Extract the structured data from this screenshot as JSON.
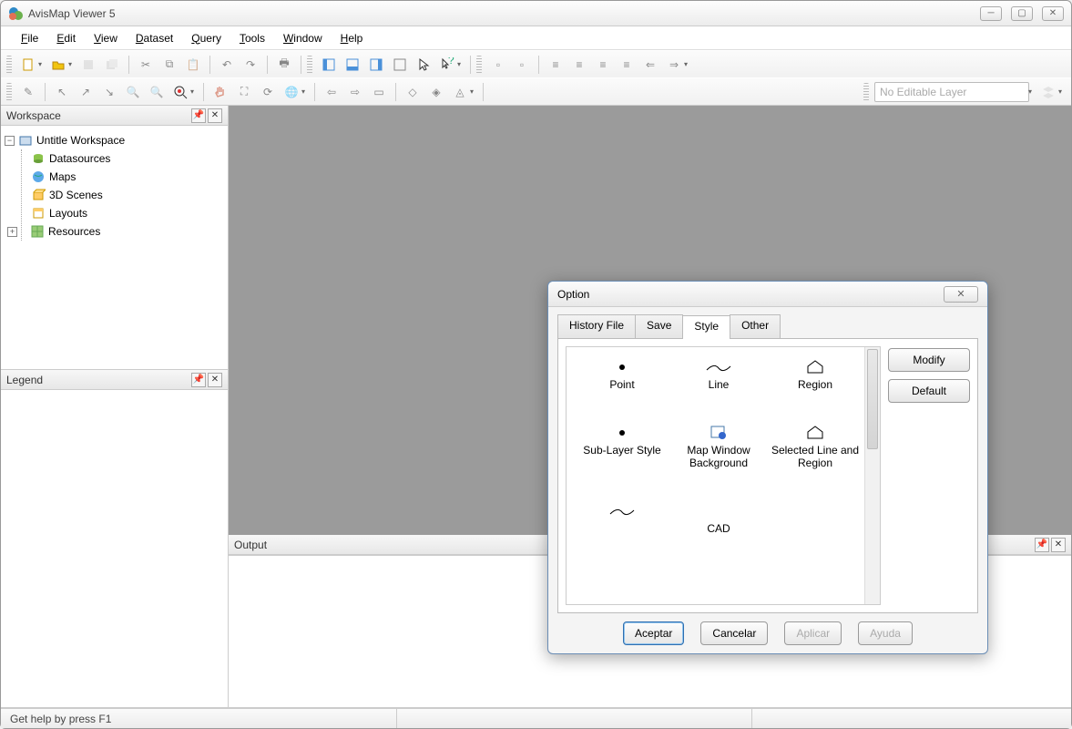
{
  "window": {
    "title": "AvisMap Viewer 5"
  },
  "menu": {
    "items": [
      "File",
      "Edit",
      "View",
      "Dataset",
      "Query",
      "Tools",
      "Window",
      "Help"
    ]
  },
  "layerCombo": {
    "placeholder": "No Editable Layer"
  },
  "panels": {
    "workspace": {
      "title": "Workspace",
      "root": "Untitle Workspace",
      "children": [
        "Datasources",
        "Maps",
        "3D Scenes",
        "Layouts",
        "Resources"
      ]
    },
    "legend": {
      "title": "Legend"
    },
    "output": {
      "title": "Output"
    }
  },
  "dialog": {
    "title": "Option",
    "tabs": [
      "History File",
      "Save",
      "Style",
      "Other"
    ],
    "activeTab": "Style",
    "styleItems": [
      "Point",
      "Line",
      "Region",
      "Sub-Layer Style",
      "Map Window Background",
      "Selected Line and Region",
      "",
      "CAD",
      ""
    ],
    "sideButtons": [
      "Modify",
      "Default"
    ],
    "buttons": {
      "accept": "Aceptar",
      "cancel": "Cancelar",
      "apply": "Aplicar",
      "help": "Ayuda"
    }
  },
  "status": {
    "hint": "Get help by press F1"
  }
}
